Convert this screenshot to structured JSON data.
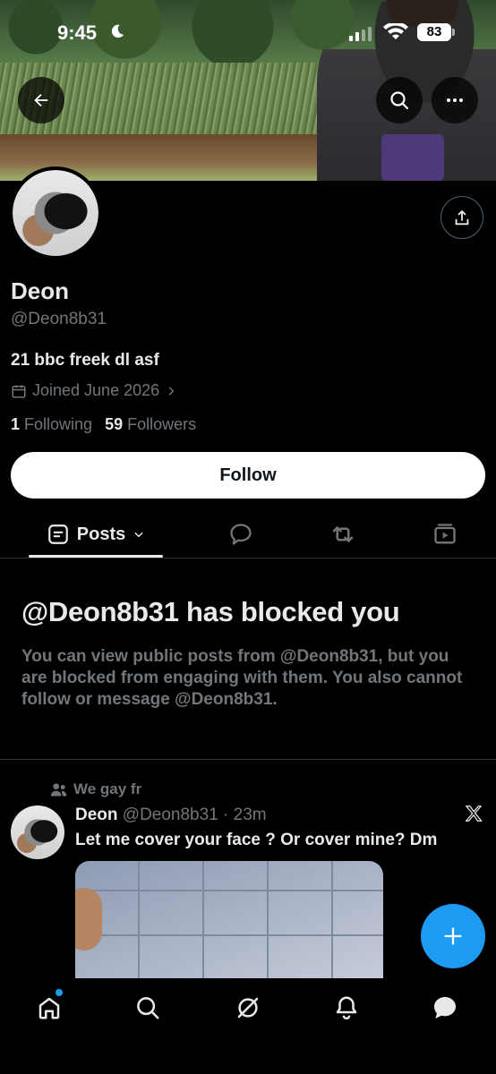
{
  "status_bar": {
    "time": "9:45",
    "battery": "83"
  },
  "profile": {
    "name": "Deon",
    "handle": "@Deon8b31",
    "bio": "21 bbc freek dl asf",
    "joined": "Joined June 2026",
    "following_count": "1",
    "following_label": "Following",
    "followers_count": "59",
    "followers_label": "Followers",
    "follow_button": "Follow"
  },
  "tabs": {
    "posts_label": "Posts"
  },
  "blocked": {
    "title": "@Deon8b31 has blocked you",
    "body": "You can view public posts from @Deon8b31, but you are blocked from engaging with them. You also cannot follow or message @Deon8b31."
  },
  "post": {
    "community": "We gay fr",
    "author_name": "Deon",
    "author_meta": "@Deon8b31 · 23m",
    "text": "Let me cover your face ? Or cover mine? Dm"
  },
  "icons": {
    "back": "arrow-left-icon",
    "search": "search-icon",
    "more": "more-icon",
    "share": "share-icon",
    "calendar": "calendar-icon",
    "replies_tab": "reply-icon",
    "reposts_tab": "repost-icon",
    "media_tab": "media-icon",
    "community": "community-icon",
    "compose": "plus-icon",
    "nav": [
      "home-icon",
      "search-icon",
      "grok-icon",
      "bell-icon",
      "messages-icon"
    ]
  },
  "colors": {
    "accent": "#1d9bf0",
    "background": "#000000",
    "muted_text": "#71767b",
    "text": "#e7e9ea"
  }
}
